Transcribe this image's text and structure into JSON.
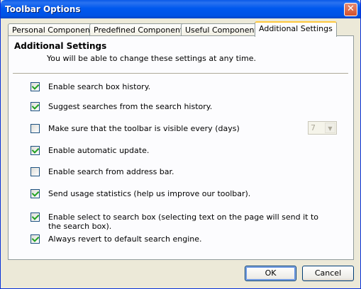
{
  "window": {
    "title": "Toolbar Options",
    "close_glyph": "✕"
  },
  "tabs": [
    {
      "label": "Personal Components"
    },
    {
      "label": "Predefined Components"
    },
    {
      "label": "Useful Components"
    },
    {
      "label": "Additional Settings",
      "active": true
    }
  ],
  "panel": {
    "title": "Additional Settings",
    "subtitle": "You will be able to change these settings at any time."
  },
  "options": [
    {
      "label": "Enable search box history.",
      "checked": true
    },
    {
      "label": "Suggest searches from the search history.",
      "checked": true
    },
    {
      "label": "Make sure that the toolbar is visible every (days)",
      "checked": false
    },
    {
      "label": "Enable automatic update.",
      "checked": true
    },
    {
      "label": "Enable search from address bar.",
      "checked": false
    },
    {
      "label": "Send usage statistics (help us improve our toolbar).",
      "checked": true
    },
    {
      "label": "Enable select to search box (selecting text on the page will send it to the search box).",
      "checked": true
    },
    {
      "label": "Always revert to default search engine.",
      "checked": true
    }
  ],
  "days_select": {
    "value": "7",
    "disabled": true
  },
  "buttons": {
    "ok": "OK",
    "cancel": "Cancel"
  },
  "colors": {
    "title_bar": "#0058ee",
    "window_bg": "#ece9d8",
    "active_tab_accent": "#ffc83c",
    "checkmark": "#21a121"
  },
  "icons": {
    "close": "close-icon",
    "checkbox_check": "checkmark-icon",
    "dropdown": "chevron-down-icon"
  }
}
